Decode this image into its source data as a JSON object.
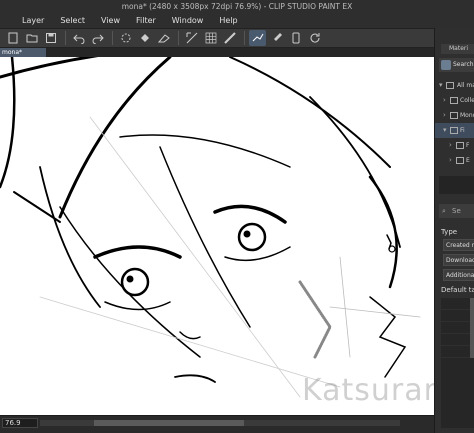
{
  "window": {
    "title": "mona* (2480 x 3508px 72dpi 76.9%) - CLIP STUDIO PAINT EX"
  },
  "menu": {
    "items": [
      "Layer",
      "Select",
      "View",
      "Filter",
      "Window",
      "Help"
    ]
  },
  "toolbar": {
    "icons": [
      "new-file-icon",
      "open-folder-icon",
      "save-icon",
      "undo-icon",
      "redo-icon",
      "loading-icon",
      "fill-icon",
      "eraser-icon",
      "transform-icon",
      "grid-icon",
      "pen-stroke-icon",
      "brush-icon",
      "tablet-icon",
      "refresh-icon"
    ],
    "active_index": 10
  },
  "document_tab": {
    "label": "mona*"
  },
  "canvas": {
    "watermark": "Katsurart"
  },
  "status": {
    "zoom": "76.9",
    "scroll_position": 0.15
  },
  "panel": {
    "header": "Materi",
    "search_label": "Search",
    "tree": [
      {
        "label": "All ma",
        "expanded": true
      },
      {
        "label": "Colle",
        "expanded": false
      },
      {
        "label": "Mono",
        "expanded": false
      },
      {
        "label": "Fi",
        "expanded": true
      },
      {
        "label": "F",
        "expanded": false
      },
      {
        "label": "E",
        "expanded": false
      }
    ],
    "search_placeholder": "Se",
    "type_label": "Type",
    "buttons": [
      "Created m",
      "Downloade",
      "Additiona"
    ],
    "default_tag_label": "Default tag"
  },
  "colors": {
    "accent": "#4c5a6c",
    "panel_bg": "#2f2f2f",
    "canvas_bg": "#ffffff"
  }
}
